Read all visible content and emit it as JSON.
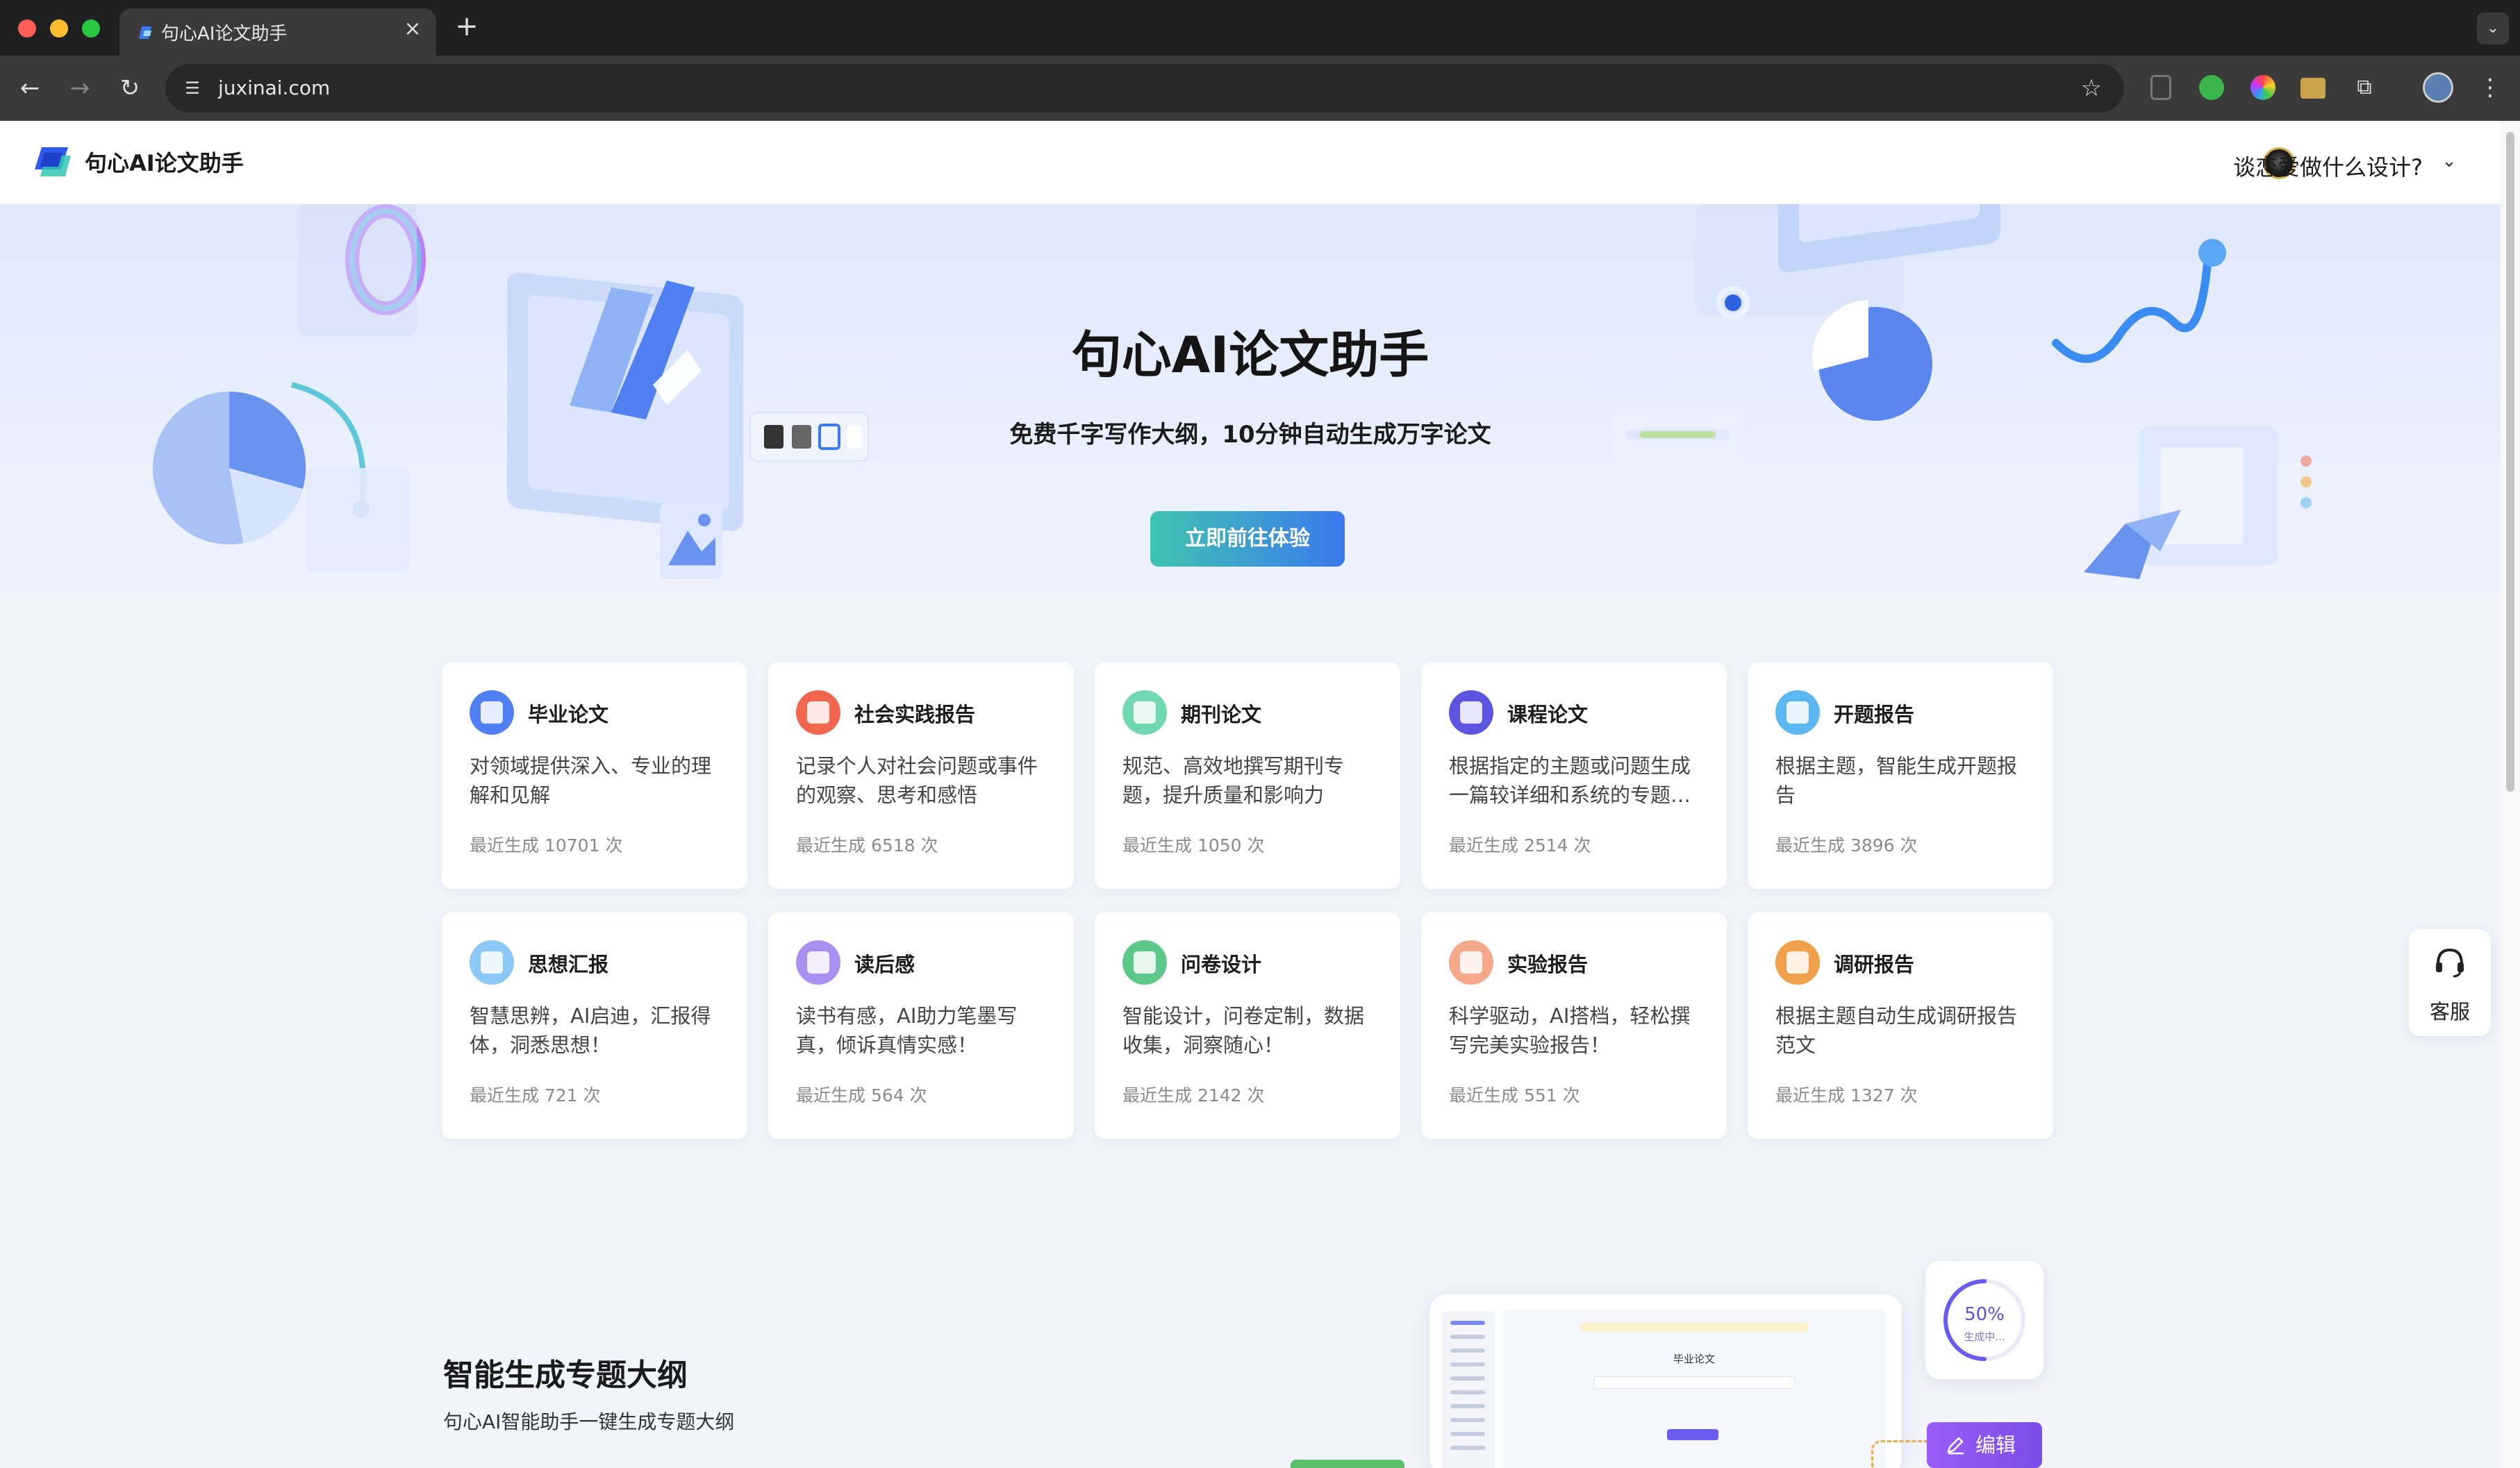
{
  "browser": {
    "tab_title": "句心AI论文助手",
    "url": "juxinai.com",
    "new_tab": "+",
    "close": "×",
    "tab_menu": "⌄",
    "back": "←",
    "forward": "→",
    "reload": "↻",
    "bookmark": "☆",
    "menu": "⋮"
  },
  "site": {
    "logo_text": "句心AI论文助手",
    "user_name": "谈恋爱做什么设计?",
    "user_caret": "⌄"
  },
  "hero": {
    "title": "句心AI论文助手",
    "subtitle": "免费千字写作大纲，10分钟自动生成万字论文",
    "cta": "立即前往体验"
  },
  "cards": [
    {
      "title": "毕业论文",
      "desc": "对领域提供深入、专业的理解和见解",
      "count": "最近生成 10701 次",
      "icon": "document-icon",
      "color": "#4f7ff0"
    },
    {
      "title": "社会实践报告",
      "desc": "记录个人对社会问题或事件的观察、思考和感悟",
      "count": "最近生成 6518 次",
      "icon": "calendar-icon",
      "color": "#f0664f"
    },
    {
      "title": "期刊论文",
      "desc": "规范、高效地撰写期刊专题，提升质量和影响力",
      "count": "最近生成 1050 次",
      "icon": "journal-icon",
      "color": "#6fd8b0"
    },
    {
      "title": "课程论文",
      "desc": "根据指定的主题或问题生成一篇较详细和系统的专题…",
      "count": "最近生成 2514 次",
      "icon": "course-doc-icon",
      "color": "#5b55e0"
    },
    {
      "title": "开题报告",
      "desc": "根据主题，智能生成开题报告",
      "count": "最近生成 3896 次",
      "icon": "book-icon",
      "color": "#5cb8f0"
    },
    {
      "title": "思想汇报",
      "desc": "智慧思辨，AI启迪，汇报得体，洞悉思想！",
      "count": "最近生成 721 次",
      "icon": "report-icon",
      "color": "#8cc8f5"
    },
    {
      "title": "读后感",
      "desc": "读书有感，AI助力笔墨写真，倾诉真情实感！",
      "count": "最近生成 564 次",
      "icon": "reading-icon",
      "color": "#a88ff0"
    },
    {
      "title": "问卷设计",
      "desc": "智能设计，问卷定制，数据收集，洞察随心！",
      "count": "最近生成 2142 次",
      "icon": "questionnaire-icon",
      "color": "#5cc98a"
    },
    {
      "title": "实验报告",
      "desc": "科学驱动，AI搭档，轻松撰写完美实验报告！",
      "count": "最近生成 551 次",
      "icon": "lab-icon",
      "color": "#f5a98a"
    },
    {
      "title": "调研报告",
      "desc": "根据主题自动生成调研报告范文",
      "count": "最近生成 1327 次",
      "icon": "location-icon",
      "color": "#f0a04a"
    }
  ],
  "service": {
    "label": "客服",
    "icon": "headset-icon"
  },
  "feature": {
    "title": "智能生成专题大纲",
    "desc": "句心AI智能助手一键生成专题大纲",
    "preview_heading": "毕业论文",
    "progress": 50,
    "progress_text": "50%",
    "progress_label": "生成中...",
    "edit_label": "编辑"
  },
  "colors": {
    "brand_blue": "#3b79ee",
    "brand_teal": "#3fc4b0",
    "accent_purple": "#7b4de8"
  }
}
